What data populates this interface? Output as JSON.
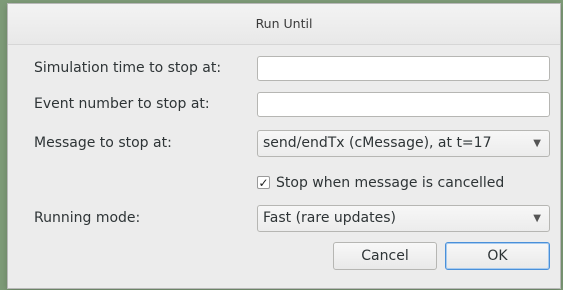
{
  "dialog": {
    "title": "Run Until"
  },
  "fields": {
    "sim_time_label": "Simulation time to stop at:",
    "sim_time_value": "",
    "event_number_label": "Event number to stop at:",
    "event_number_value": "",
    "message_label": "Message to stop at:",
    "message_value": "send/endTx (cMessage), at t=17",
    "stop_cancelled_label": "Stop when message is cancelled",
    "stop_cancelled_checked": true,
    "running_mode_label": "Running mode:",
    "running_mode_value": "Fast (rare updates)"
  },
  "buttons": {
    "cancel": "Cancel",
    "ok": "OK"
  },
  "icons": {
    "dropdown": "chevron-down-icon",
    "check": "checkmark-icon"
  }
}
